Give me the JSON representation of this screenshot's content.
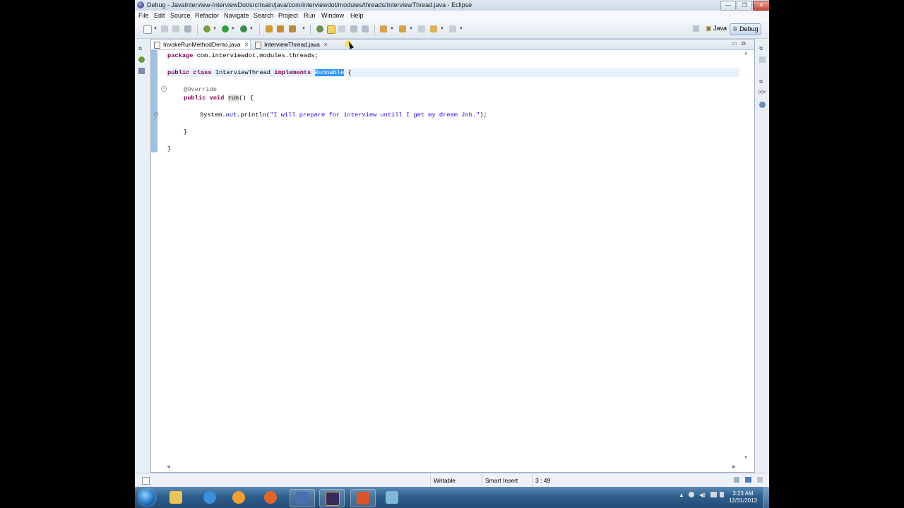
{
  "window": {
    "title": "Debug - JavaInterview-InterviewDot/src/main/java/com/interviewdot/modules/threads/InterviewThread.java - Eclipse",
    "controls": {
      "minimize": "—",
      "maximize": "❐",
      "close": "✕"
    }
  },
  "menu": [
    "File",
    "Edit",
    "Source",
    "Refactor",
    "Navigate",
    "Search",
    "Project",
    "Run",
    "Window",
    "Help"
  ],
  "perspectives": {
    "java": "Java",
    "debug": "Debug"
  },
  "editor": {
    "tabs": [
      {
        "label": "InvokeRunMethodDemo.java",
        "active": true
      },
      {
        "label": "InterviewThread.java",
        "active": false
      }
    ],
    "code": {
      "package_kw": "package",
      "package_name": " com.interviewdot.modules.threads;",
      "class_public": "public",
      "class_kw": "class",
      "class_name": " InterviewThread ",
      "implements_kw": "implements",
      "iface": "Runnable",
      "open_brace": " {",
      "override": "@Override",
      "method_public": "public",
      "method_void": "void",
      "method_name": "run",
      "method_sig_rest": "() {",
      "stmt_prefix": "System.",
      "stmt_field": "out",
      "stmt_call": ".println(",
      "stmt_string": "\"I will prepare for interview untill I get my dream Job.\"",
      "stmt_end": ");",
      "close_method": "}",
      "close_class": "}"
    }
  },
  "status": {
    "writable": "Writable",
    "insert_mode": "Smart Insert",
    "cursor_position": "3 : 49"
  },
  "taskbar": {
    "clock_time": "3:23 AM",
    "clock_date": "12/31/2013"
  },
  "colors": {
    "keyword": "#7f0055",
    "string": "#2a00ff",
    "annotation": "#646464",
    "selection": "#3399ff",
    "taskbar": "#2e5e8c"
  },
  "icons": [
    "eclipse-icon",
    "new-icon",
    "save-icon",
    "print-icon",
    "debug-icon",
    "run-icon",
    "external-tools-icon",
    "open-type-icon",
    "search-icon",
    "annotation-icon",
    "mark-occurrences-icon",
    "next-annotation-icon",
    "back-icon",
    "forward-icon",
    "open-perspective-icon",
    "java-perspective-icon",
    "debug-perspective-icon",
    "windows-start-icon",
    "explorer-icon",
    "ie-icon",
    "media-player-icon",
    "firefox-icon",
    "eclipse-taskbar-icon",
    "ide-icon",
    "office-icon",
    "app-icon"
  ]
}
